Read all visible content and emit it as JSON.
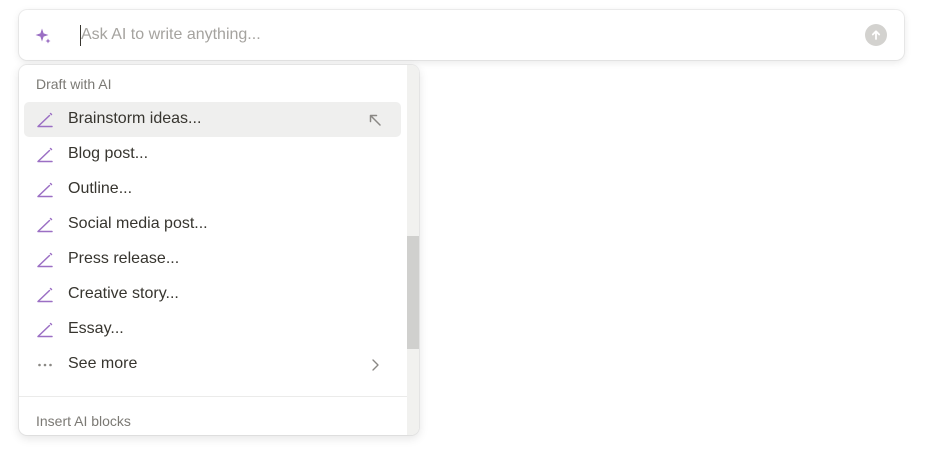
{
  "prompt": {
    "placeholder": "Ask AI to write anything...",
    "value": ""
  },
  "icons": {
    "prompt_left": "sparkle-icon",
    "submit": "arrow-up-circle-icon",
    "item": "pen-icon",
    "more": "ellipsis-icon",
    "chevron": "chevron-right-icon",
    "enter_hint": "arrow-up-left-icon"
  },
  "colors": {
    "accent_purple": "#9b6fc4",
    "hover_bg": "#efefee",
    "section_text": "#7b7974"
  },
  "menu": {
    "draft_section_title": "Draft with AI",
    "items": [
      {
        "label": "Brainstorm ideas...",
        "active": true
      },
      {
        "label": "Blog post..."
      },
      {
        "label": "Outline..."
      },
      {
        "label": "Social media post..."
      },
      {
        "label": "Press release..."
      },
      {
        "label": "Creative story..."
      },
      {
        "label": "Essay..."
      }
    ],
    "see_more_label": "See more",
    "insert_section_title": "Insert AI blocks"
  }
}
